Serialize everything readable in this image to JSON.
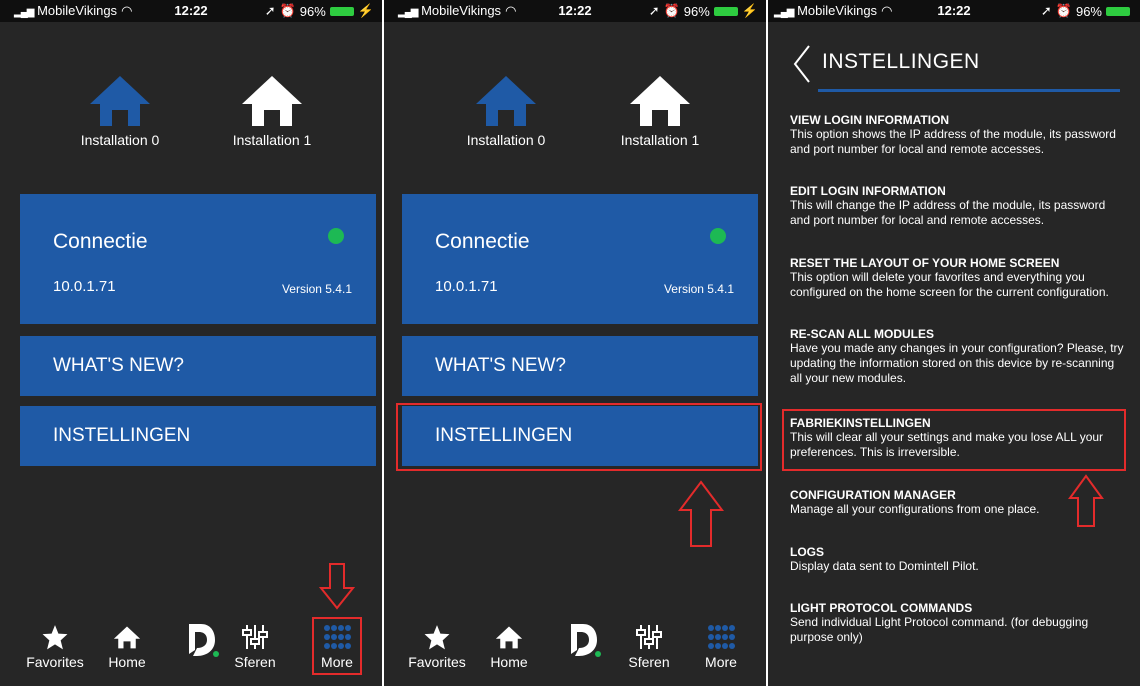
{
  "status": {
    "carrier": "MobileVikings",
    "time": "12:22",
    "battery": "96%"
  },
  "installations": [
    {
      "label": "Installation 0",
      "color": "#1f5aa6"
    },
    {
      "label": "Installation 1",
      "color": "#ffffff"
    }
  ],
  "connection": {
    "title": "Connectie",
    "ip": "10.0.1.71",
    "version": "Version 5.4.1",
    "status_color": "#1db954"
  },
  "menu": {
    "whats_new": "WHAT'S NEW?",
    "settings": "INSTELLINGEN"
  },
  "tabbar": {
    "items": [
      {
        "label": "Favorites",
        "icon": "star-icon"
      },
      {
        "label": "Home",
        "icon": "home-icon"
      },
      {
        "label": "",
        "icon": "domintell-logo-icon"
      },
      {
        "label": "Sferen",
        "icon": "sliders-icon"
      },
      {
        "label": "More",
        "icon": "grid-icon"
      }
    ]
  },
  "settings": {
    "title": "INSTELLINGEN",
    "options": [
      {
        "title": "VIEW LOGIN INFORMATION",
        "desc": "This option shows the IP address of the module, its password and port number for local and remote accesses."
      },
      {
        "title": "EDIT LOGIN INFORMATION",
        "desc": "This will change the IP address of the module, its password and port number for local and remote accesses."
      },
      {
        "title": "RESET THE LAYOUT OF YOUR HOME SCREEN",
        "desc": "This option will delete your favorites and everything you configured on the home screen for the current configuration."
      },
      {
        "title": "RE-SCAN ALL MODULES",
        "desc": "Have you made any changes in your configuration? Please, try updating the information stored on this device by re-scanning all your new modules."
      },
      {
        "title": "FABRIEKINSTELLINGEN",
        "desc": "This will clear all your settings and make you lose ALL your preferences. This is irreversible."
      },
      {
        "title": "CONFIGURATION MANAGER",
        "desc": "Manage all your configurations from one place."
      },
      {
        "title": "LOGS",
        "desc": "Display data sent to Domintell Pilot."
      },
      {
        "title": "LIGHT PROTOCOL COMMANDS",
        "desc": "Send individual Light Protocol command. (for debugging purpose only)"
      }
    ]
  },
  "colors": {
    "accent": "#1f5aa6",
    "highlight": "#e32b2b",
    "background": "#262626"
  }
}
